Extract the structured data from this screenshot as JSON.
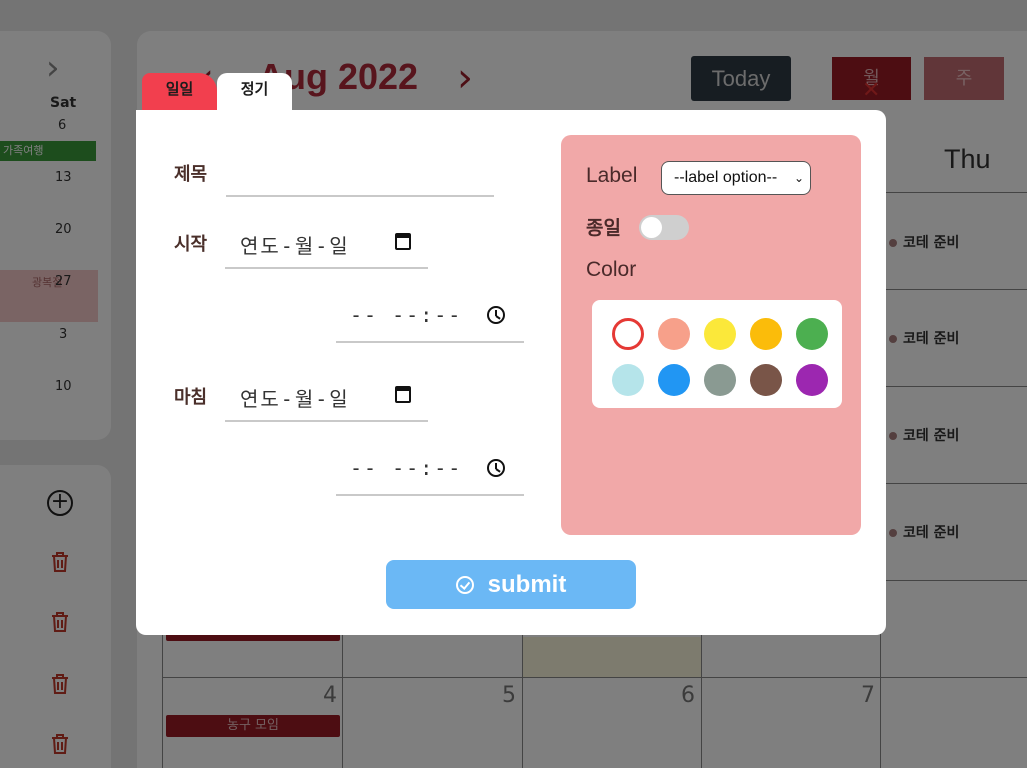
{
  "mini_calendar": {
    "next_arrow": "›",
    "day_of_week": "Sat",
    "dates": [
      "6",
      "13",
      "20",
      "27",
      "3",
      "10"
    ],
    "event_label": "가족여행",
    "highlight_label": "광복절"
  },
  "side_actions": {
    "add_icon": "+"
  },
  "calendar": {
    "prev_arrow": "‹",
    "title": "Aug 2022",
    "next_arrow": "›",
    "today_label": "Today",
    "month_label": "월",
    "week_label": "주",
    "column_header": "Thu",
    "todos": [
      "코테 준비",
      "코테 준비",
      "코테 준비",
      "코테 준비"
    ],
    "day_numbers": [
      "4",
      "5",
      "6",
      "7"
    ],
    "events": [
      "농구 모임"
    ]
  },
  "modal": {
    "tabs": {
      "daily": "일일",
      "regular": "정기"
    },
    "title_label": "제목",
    "title_value": "",
    "start_label": "시작",
    "end_label": "마침",
    "date_placeholder": "연도-월-일",
    "time_placeholder": "-- --:--",
    "label_label": "Label",
    "label_select": "--label option--",
    "allday_label": "종일",
    "allday_on": false,
    "color_label": "Color",
    "colors": [
      "#ffffff",
      "#f7a08a",
      "#fbe83a",
      "#fbbc0a",
      "#4caf50",
      "#b5e4ea",
      "#2196f3",
      "#8a9a92",
      "#795548",
      "#9c27b0"
    ],
    "selected_color_border": "#e53935",
    "submit_label": "submit"
  }
}
